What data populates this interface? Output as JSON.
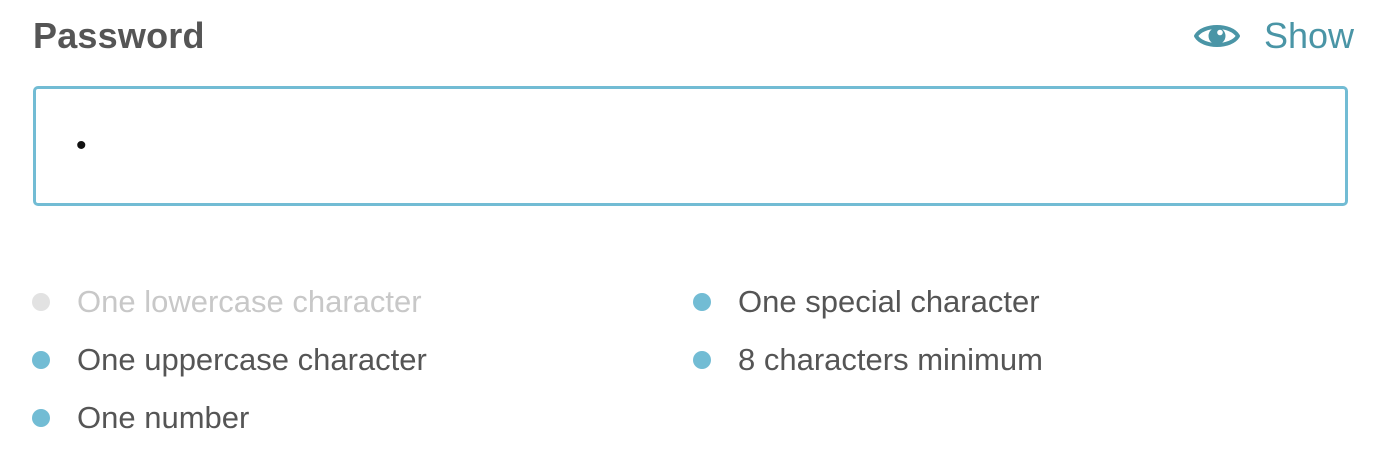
{
  "field": {
    "label": "Password",
    "toggle_label": "Show",
    "toggle_icon": "eye-icon",
    "value": "•"
  },
  "rules": {
    "lowercase": {
      "label": "One lowercase character",
      "met": false
    },
    "uppercase": {
      "label": "One uppercase character",
      "met": true
    },
    "number": {
      "label": "One number",
      "met": true
    },
    "special": {
      "label": "One special character",
      "met": true
    },
    "minimum": {
      "label": "8 characters minimum",
      "met": true
    }
  },
  "colors": {
    "accent": "#72bcd4",
    "link": "#4a95a6",
    "text": "#555555",
    "inactive_text": "#c8c8c8",
    "inactive_dot": "#e2e2e2"
  }
}
